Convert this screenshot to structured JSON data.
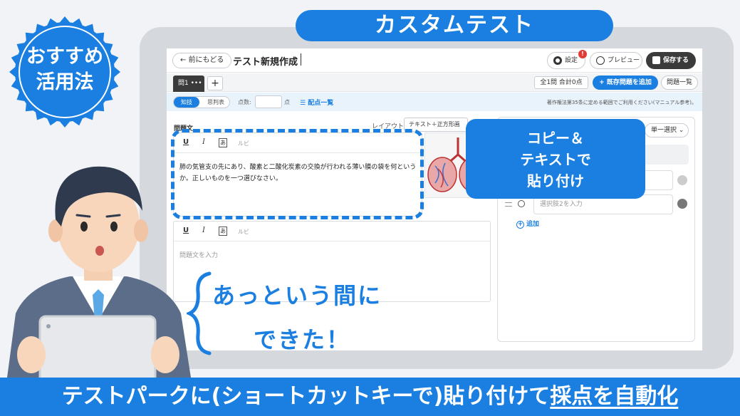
{
  "banner": {
    "title": "カスタムテスト"
  },
  "badge": {
    "line1": "おすすめ",
    "line2": "活用法"
  },
  "app": {
    "back_label": "前にもどる",
    "doc_title": "テスト新規作成",
    "settings_label": "設定",
    "notification_count": "!",
    "preview_label": "プレビュー",
    "save_label": "保存する"
  },
  "tabs": {
    "question_tab": "問1 •••",
    "add_tab": "+",
    "count": "全1問 合計0点",
    "add_existing": "+ 既存問題を追加",
    "question_list": "問題一覧"
  },
  "settings": {
    "mode_a": "知技",
    "mode_b": "思判表",
    "points_label": "点数:",
    "points_unit": "点",
    "points_list": "☰ 配点一覧",
    "copyright": "著作権法第35条に定める範囲でご利用ください(マニュアル参考)。"
  },
  "editor": {
    "question_label": "問題文",
    "layout_label": "レイアウト",
    "layout_value": "テキスト＋正方形画",
    "toolbar_ruby": "ルビ",
    "question_text": "肺の気管支の先にあり、酸素と二酸化炭素の交換が行われる薄い膜の袋を何というか。正しいものを一つ選びなさい。",
    "placeholder": "問題文を入力"
  },
  "answer": {
    "type_value": "単一選択",
    "choice2_placeholder": "選択肢2を入力",
    "add_label": "追加"
  },
  "callout": {
    "text": "コピー＆\nテキストで\n貼り付け"
  },
  "speech": {
    "line1": "あっという間に",
    "line2": "できた！"
  },
  "footer": {
    "prefix": "テストパークに(ショートカットキーで)貼り付けて",
    "highlight": "採点を自動化"
  },
  "colors": {
    "accent": "#1a7fe0",
    "dark": "#3b3b3b"
  }
}
